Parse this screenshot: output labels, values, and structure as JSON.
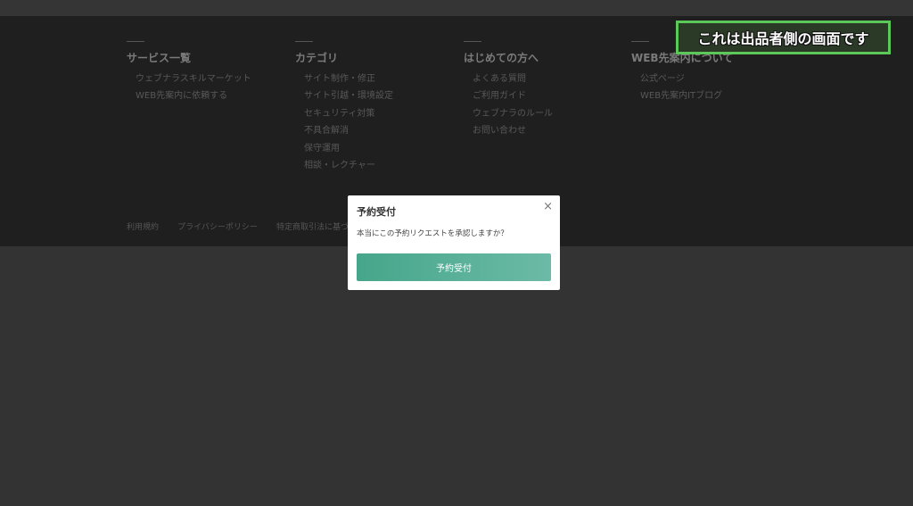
{
  "annotation": {
    "text": "これは出品者側の画面です"
  },
  "footer": {
    "columns": [
      {
        "heading": "サービス一覧",
        "items": [
          "ウェブナラスキルマーケット",
          "WEB先案内に依頼する"
        ]
      },
      {
        "heading": "カテゴリ",
        "items": [
          "サイト制作・修正",
          "サイト引越・環境設定",
          "セキュリティ対策",
          "不具合解消",
          "保守運用",
          "相談・レクチャー"
        ]
      },
      {
        "heading": "はじめての方へ",
        "items": [
          "よくある質問",
          "ご利用ガイド",
          "ウェブナラのルール",
          "お問い合わせ"
        ]
      },
      {
        "heading": "WEB先案内について",
        "items": [
          "公式ページ",
          "WEB先案内ITブログ"
        ]
      }
    ],
    "legal": [
      "利用規約",
      "プライバシーポリシー",
      "特定商取引法に基づく表記"
    ]
  },
  "modal": {
    "title": "予約受付",
    "close": "×",
    "message": "本当にこの予約リクエストを承認しますか？",
    "confirm_label": "予約受付"
  },
  "colors": {
    "button_gradient_start": "#46a68a",
    "button_gradient_end": "#6cbaa7",
    "annotation_border": "#5cc85a"
  }
}
